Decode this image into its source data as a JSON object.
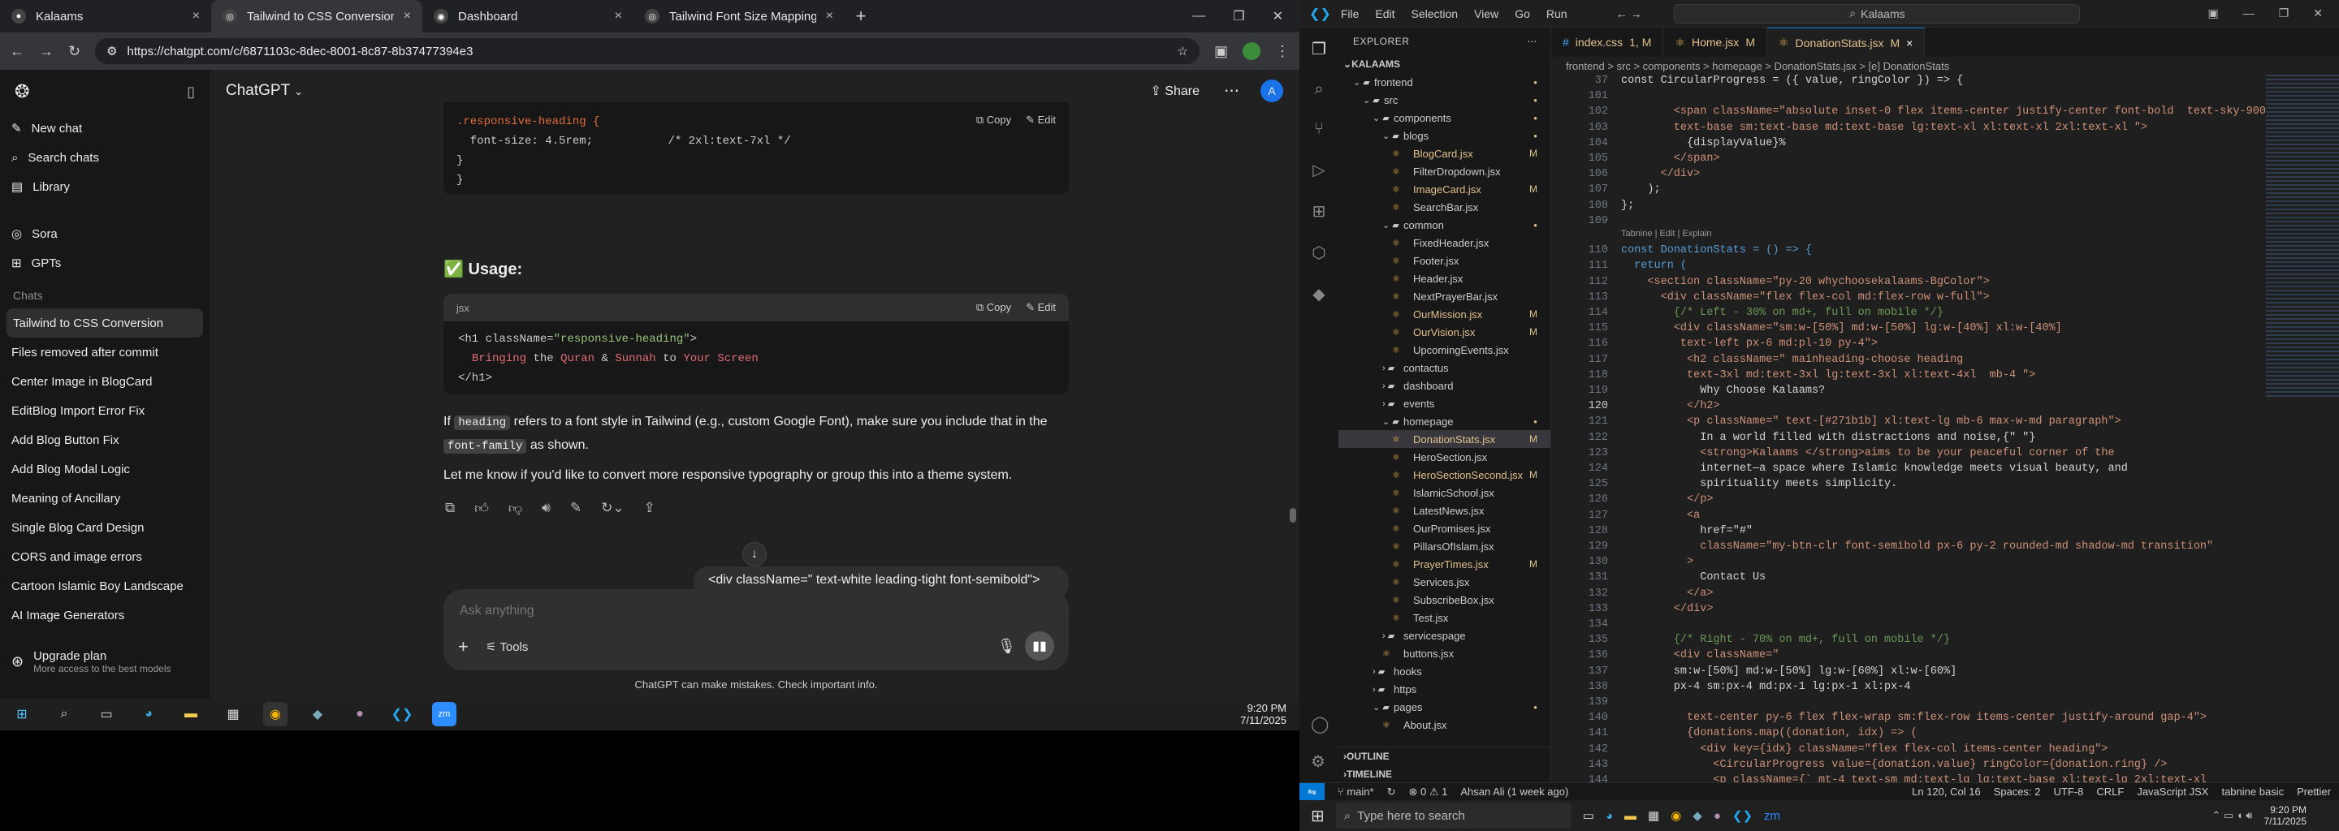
{
  "browser": {
    "tabs": [
      {
        "title": "Kalaams"
      },
      {
        "title": "Tailwind to CSS Conversion"
      },
      {
        "title": "Dashboard"
      },
      {
        "title": "Tailwind Font Size Mapping"
      }
    ],
    "url": "https://chatgpt.com/c/6871103c-8dec-8001-8c87-8b37477394e3"
  },
  "sidebar": {
    "items": [
      "New chat",
      "Search chats",
      "Library"
    ],
    "apps": [
      "Sora",
      "GPTs"
    ],
    "chats_heading": "Chats",
    "chats": [
      "Tailwind to CSS Conversion",
      "Files removed after commit",
      "Center Image in BlogCard",
      "EditBlog Import Error Fix",
      "Add Blog Button Fix",
      "Add Blog Modal Logic",
      "Meaning of Ancillary",
      "Single Blog Card Design",
      "CORS and image errors",
      "Cartoon Islamic Boy Landscape",
      "AI Image Generators"
    ],
    "upgrade_title": "Upgrade plan",
    "upgrade_sub": "More access to the best models"
  },
  "chat": {
    "model": "ChatGPT",
    "share": "Share",
    "avatar": "A",
    "code1_lines": [
      ".responsive-heading {",
      "  font-size: 4.5rem;           /* 2xl:text-7xl */",
      "}",
      "}"
    ],
    "copy": "Copy",
    "edit": "Edit",
    "usage_heading": "Usage:",
    "code2_lang": "jsx",
    "code2_l1_a": "<h1 className=",
    "code2_l1_b": "\"responsive-heading\"",
    "code2_l1_c": ">",
    "code2_l2": [
      "Bringing",
      "the",
      "Quran",
      "&",
      "Sunnah",
      "to",
      "Your Screen"
    ],
    "code2_l3": "</h1>",
    "p1_a": "If",
    "p1_code": "heading",
    "p1_b": "refers to a font style in Tailwind (e.g., custom Google Font), make sure you include that in the",
    "p1_code2": "font-family",
    "p1_c": "as shown.",
    "p2": "Let me know if you'd like to convert more responsive typography or group this into a theme system.",
    "peek": "<div className=\" text-white leading-tight font-semibold\">",
    "placeholder": "Ask anything",
    "tools": "Tools",
    "disclaimer": "ChatGPT can make mistakes. Check important info."
  },
  "taskbar_left": {
    "time": "9:20 PM",
    "date": "7/11/2025"
  },
  "vscode": {
    "menu": [
      "File",
      "Edit",
      "Selection",
      "View",
      "Go",
      "Run"
    ],
    "search": "Kalaams",
    "explorer_title": "EXPLORER",
    "root": "KALAAMS",
    "tree": [
      {
        "n": "frontend",
        "d": 1,
        "folder": true,
        "open": true,
        "dot": true
      },
      {
        "n": "src",
        "d": 2,
        "folder": true,
        "open": true,
        "dot": true
      },
      {
        "n": "components",
        "d": 3,
        "folder": true,
        "open": true,
        "dot": true
      },
      {
        "n": "blogs",
        "d": 4,
        "folder": true,
        "open": true,
        "dot": true
      },
      {
        "n": "BlogCard.jsx",
        "d": 5,
        "m": "M"
      },
      {
        "n": "FilterDropdown.jsx",
        "d": 5
      },
      {
        "n": "ImageCard.jsx",
        "d": 5,
        "m": "M"
      },
      {
        "n": "SearchBar.jsx",
        "d": 5
      },
      {
        "n": "common",
        "d": 4,
        "folder": true,
        "open": true,
        "dot": true
      },
      {
        "n": "FixedHeader.jsx",
        "d": 5
      },
      {
        "n": "Footer.jsx",
        "d": 5
      },
      {
        "n": "Header.jsx",
        "d": 5
      },
      {
        "n": "NextPrayerBar.jsx",
        "d": 5
      },
      {
        "n": "OurMission.jsx",
        "d": 5,
        "m": "M"
      },
      {
        "n": "OurVision.jsx",
        "d": 5,
        "m": "M"
      },
      {
        "n": "UpcomingEvents.jsx",
        "d": 5
      },
      {
        "n": "contactus",
        "d": 4,
        "folder": true
      },
      {
        "n": "dashboard",
        "d": 4,
        "folder": true
      },
      {
        "n": "events",
        "d": 4,
        "folder": true
      },
      {
        "n": "homepage",
        "d": 4,
        "folder": true,
        "open": true,
        "dot": true
      },
      {
        "n": "DonationStats.jsx",
        "d": 5,
        "m": "M",
        "sel": true
      },
      {
        "n": "HeroSection.jsx",
        "d": 5
      },
      {
        "n": "HeroSectionSecond.jsx",
        "d": 5,
        "m": "M"
      },
      {
        "n": "IslamicSchool.jsx",
        "d": 5
      },
      {
        "n": "LatestNews.jsx",
        "d": 5
      },
      {
        "n": "OurPromises.jsx",
        "d": 5
      },
      {
        "n": "PillarsOfIslam.jsx",
        "d": 5
      },
      {
        "n": "PrayerTimes.jsx",
        "d": 5,
        "m": "M"
      },
      {
        "n": "Services.jsx",
        "d": 5
      },
      {
        "n": "SubscribeBox.jsx",
        "d": 5
      },
      {
        "n": "Test.jsx",
        "d": 5
      },
      {
        "n": "servicespage",
        "d": 4,
        "folder": true
      },
      {
        "n": "buttons.jsx",
        "d": 4
      },
      {
        "n": "hooks",
        "d": 3,
        "folder": true
      },
      {
        "n": "https",
        "d": 3,
        "folder": true
      },
      {
        "n": "pages",
        "d": 3,
        "folder": true,
        "open": true,
        "dot": true
      },
      {
        "n": "About.jsx",
        "d": 4
      }
    ],
    "outline": "OUTLINE",
    "timeline": "TIMELINE",
    "tabs": [
      {
        "n": "index.css",
        "s": "1, M"
      },
      {
        "n": "Home.jsx",
        "s": "M"
      },
      {
        "n": "DonationStats.jsx",
        "s": "M",
        "act": true
      }
    ],
    "breadcrumb": "frontend > src > components > homepage > DonationStats.jsx > [e] DonationStats",
    "sticky": "const CircularProgress = ({ value, ringColor }) => {",
    "codelens": "Tabnine | Edit | Explain",
    "lines": [
      {
        "n": "37",
        "t": ""
      },
      {
        "n": "101",
        "t": ""
      },
      {
        "n": "102",
        "t": "        <span className=\"absolute inset-0 flex items-center justify-center font-bold  text-sky-900"
      },
      {
        "n": "103",
        "t": "        text-base sm:text-base md:text-base lg:text-xl xl:text-xl 2xl:text-xl \">"
      },
      {
        "n": "104",
        "t": "          {displayValue}%"
      },
      {
        "n": "105",
        "t": "        </span>"
      },
      {
        "n": "106",
        "t": "      </div>"
      },
      {
        "n": "107",
        "t": "    );"
      },
      {
        "n": "108",
        "t": "};"
      },
      {
        "n": "109",
        "t": ""
      },
      {
        "n": "110",
        "t": "const DonationStats = () => {"
      },
      {
        "n": "111",
        "t": "  return ("
      },
      {
        "n": "112",
        "t": "    <section className=\"py-20 whychoosekalaams-BgColor\">"
      },
      {
        "n": "113",
        "t": "      <div className=\"flex flex-col md:flex-row w-full\">"
      },
      {
        "n": "114",
        "t": "        {/* Left - 30% on md+, full on mobile */}"
      },
      {
        "n": "115",
        "t": "        <div className=\"sm:w-[50%] md:w-[50%] lg:w-[40%] xl:w-[40%]"
      },
      {
        "n": "116",
        "t": "         text-left px-6 md:pl-10 py-4\">"
      },
      {
        "n": "117",
        "t": "          <h2 className=\" mainheading-choose heading"
      },
      {
        "n": "118",
        "t": "          text-3xl md:text-3xl lg:text-3xl xl:text-4xl  mb-4 \">"
      },
      {
        "n": "119",
        "t": "            Why Choose Kalaams?"
      },
      {
        "n": "120",
        "t": "          </h2>"
      },
      {
        "n": "121",
        "t": "          <p className=\" text-[#271b1b] xl:text-lg mb-6 max-w-md paragraph\">"
      },
      {
        "n": "122",
        "t": "            In a world filled with distractions and noise,{\" \"}"
      },
      {
        "n": "123",
        "t": "            <strong>Kalaams </strong>aims to be your peaceful corner of the"
      },
      {
        "n": "124",
        "t": "            internet—a space where Islamic knowledge meets visual beauty, and"
      },
      {
        "n": "125",
        "t": "            spirituality meets simplicity."
      },
      {
        "n": "126",
        "t": "          </p>"
      },
      {
        "n": "127",
        "t": "          <a"
      },
      {
        "n": "128",
        "t": "            href=\"#\""
      },
      {
        "n": "129",
        "t": "            className=\"my-btn-clr font-semibold px-6 py-2 rounded-md shadow-md transition\""
      },
      {
        "n": "130",
        "t": "          >"
      },
      {
        "n": "131",
        "t": "            Contact Us"
      },
      {
        "n": "132",
        "t": "          </a>"
      },
      {
        "n": "133",
        "t": "        </div>"
      },
      {
        "n": "134",
        "t": ""
      },
      {
        "n": "135",
        "t": "        {/* Right - 70% on md+, full on mobile */}"
      },
      {
        "n": "136",
        "t": "        <div className=\""
      },
      {
        "n": "137",
        "t": "        sm:w-[50%] md:w-[50%] lg:w-[60%] xl:w-[60%]"
      },
      {
        "n": "138",
        "t": "        px-4 sm:px-4 md:px-1 lg:px-1 xl:px-4"
      },
      {
        "n": "139",
        "t": ""
      },
      {
        "n": "140",
        "t": "          text-center py-6 flex flex-wrap sm:flex-row items-center justify-around gap-4\">"
      },
      {
        "n": "141",
        "t": "          {donations.map((donation, idx) => ("
      },
      {
        "n": "142",
        "t": "            <div key={idx} className=\"flex flex-col items-center heading\">"
      },
      {
        "n": "143",
        "t": "              <CircularProgress value={donation.value} ringColor={donation.ring} />"
      },
      {
        "n": "144",
        "t": "              <p className={` mt-4 text-sm md:text-lg lg:text-base xl:text-lg 2xl:text-xl"
      }
    ],
    "status": {
      "branch": "main*",
      "errors": "0",
      "warnings": "1",
      "blame": "Ahsan Ali (1 week ago)",
      "pos": "Ln 120, Col 16",
      "spaces": "Spaces: 2",
      "enc": "UTF-8",
      "eol": "CRLF",
      "lang": "JavaScript JSX",
      "tabnine": "tabnine basic",
      "prettier": "Prettier"
    }
  },
  "taskbar_right": {
    "search": "Type here to search",
    "time": "9:20 PM",
    "date": "7/11/2025"
  }
}
